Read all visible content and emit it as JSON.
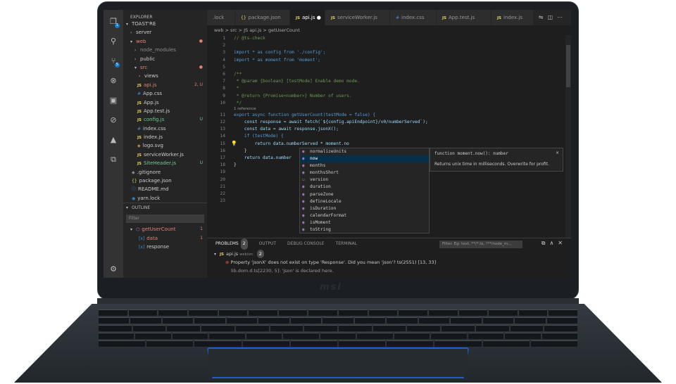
{
  "activity_bar": {
    "icons": [
      "files-icon",
      "search-icon",
      "source-control-icon",
      "debug-icon",
      "extensions-icon",
      "git-icon",
      "azure-icon",
      "deploy-icon",
      "gear-icon"
    ],
    "badges": {
      "files": "1",
      "source_control": "5"
    }
  },
  "explorer": {
    "title": "EXPLORER",
    "root": "TOAST'RE",
    "items": [
      {
        "label": "server",
        "status": ""
      },
      {
        "label": "web",
        "status": "●"
      },
      {
        "label": "node_modules",
        "status": ""
      },
      {
        "label": "public",
        "status": ""
      },
      {
        "label": "src",
        "status": "●"
      },
      {
        "label": "views",
        "status": ""
      },
      {
        "label": "api.js",
        "status": "2, U"
      },
      {
        "label": "App.css",
        "status": ""
      },
      {
        "label": "App.js",
        "status": ""
      },
      {
        "label": "App.test.js",
        "status": ""
      },
      {
        "label": "config.js",
        "status": "U"
      },
      {
        "label": "index.css",
        "status": ""
      },
      {
        "label": "index.js",
        "status": ""
      },
      {
        "label": "logo.svg",
        "status": ""
      },
      {
        "label": "serviceWorker.js",
        "status": ""
      },
      {
        "label": "SiteHeader.js",
        "status": "U"
      },
      {
        "label": ".gitignore",
        "status": ""
      },
      {
        "label": "package.json",
        "status": ""
      },
      {
        "label": "README.md",
        "status": ""
      },
      {
        "label": "yarn.lock",
        "status": ""
      }
    ],
    "outline_title": "OUTLINE",
    "filter_placeholder": "Filter",
    "outline_items": [
      {
        "label": "getUserCount",
        "status": "1"
      },
      {
        "label": "data",
        "status": "1"
      },
      {
        "label": "response",
        "status": ""
      }
    ]
  },
  "tabs": [
    {
      "label": ".lock"
    },
    {
      "label": "package.json"
    },
    {
      "label": "api.js"
    },
    {
      "label": "serviceWorker.js"
    },
    {
      "label": "index.css"
    },
    {
      "label": "App.test.js"
    },
    {
      "label": "index.js"
    }
  ],
  "breadcrumb": "web > src > JS api.js > getUserCount",
  "code": {
    "line_numbers": [
      "1",
      "2",
      "3",
      "4",
      "5",
      "6",
      "7",
      "8",
      "9",
      "10",
      "11",
      "12",
      "13",
      "14",
      "15",
      "16",
      "17",
      "18",
      "19",
      "20",
      "21",
      "22",
      "23"
    ],
    "codelens": "1 reference",
    "lines": [
      "// @ts-check",
      "",
      "import * as config from './config';",
      "import * as moment from 'moment';",
      "",
      "/**",
      " * @param {boolean} [testMode] Enable demo mode.",
      " *",
      " * @return {Promise<number>} Number of users.",
      " */",
      "export async function getUserCount(testMode = false) {",
      "    const response = await fetch(`${config.apiEndpoint}/v0/numberServed`);",
      "    const data = await response.jsonX();",
      "    if (testMode) {",
      "        return data.numberServed * moment.no",
      "    }",
      "    return data.number",
      "}"
    ]
  },
  "suggestions": [
    "normalizeUnits",
    "now",
    "months",
    "monthsShort",
    "version",
    "duration",
    "parseZone",
    "defineLocale",
    "isDuration",
    "calendarFormat",
    "isMoment",
    "toString"
  ],
  "hover": {
    "signature": "function moment.now(): number",
    "description": "Returns unix time in milliseconds. Overwrite for profit.",
    "close": "×"
  },
  "panel": {
    "tabs": [
      "PROBLEMS",
      "OUTPUT",
      "DEBUG CONSOLE",
      "TERMINAL"
    ],
    "problems_count": "2",
    "filter_placeholder": "Filter. Eg: text, **/*.ts, !**/node_m...",
    "file": "api.js",
    "file_dir": "web/src",
    "file_count": "2",
    "error": "Property 'jsonX' does not exist on type 'Response'. Did you mean 'json'? ts(2551) [13, 33]",
    "related": "lib.dom.d.ts[2230, 5]: 'json' is declared here."
  },
  "brand": "msi"
}
